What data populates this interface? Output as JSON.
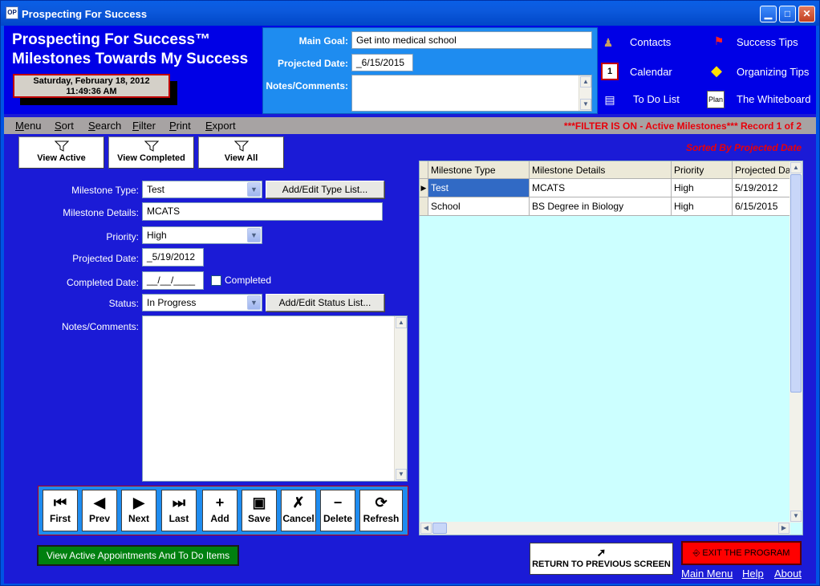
{
  "window": {
    "title": "Prospecting For Success",
    "icon_label": "OP"
  },
  "header": {
    "title_line1": "Prospecting For Success™",
    "title_line2": "Milestones Towards My Success",
    "date": "Saturday, February 18, 2012",
    "time": "11:49:36 AM"
  },
  "goal": {
    "main_goal_label": "Main Goal:",
    "main_goal_value": "Get into medical school",
    "projected_date_label": "Projected Date:",
    "projected_date_value": "_6/15/2015",
    "notes_label": "Notes/Comments:",
    "notes_value": ""
  },
  "quick_links": [
    {
      "label": "Contacts",
      "icon": "contacts-icon"
    },
    {
      "label": "Success Tips",
      "icon": "flag-icon"
    },
    {
      "label": "Calendar",
      "icon": "calendar-icon"
    },
    {
      "label": "Organizing Tips",
      "icon": "organizing-icon"
    },
    {
      "label": "To Do List",
      "icon": "todo-icon"
    },
    {
      "label": "The Whiteboard",
      "icon": "whiteboard-icon"
    }
  ],
  "menu": {
    "items": [
      "Menu",
      "Sort",
      "Search",
      "Filter",
      "Print",
      "Export"
    ],
    "filter_status": "***FILTER IS ON - Active Milestones***   Record 1 of 2"
  },
  "view_buttons": [
    "View Active",
    "View Completed",
    "View All"
  ],
  "sorted_by": "Sorted By Projected Date",
  "form": {
    "type_label": "Milestone Type:",
    "type_value": "Test",
    "type_button": "Add/Edit Type List...",
    "details_label": "Milestone Details:",
    "details_value": "MCATS",
    "priority_label": "Priority:",
    "priority_value": "High",
    "projected_label": "Projected Date:",
    "projected_value": "_5/19/2012",
    "completed_label": "Completed Date:",
    "completed_value": "__/__/____",
    "completed_check_label": "Completed",
    "status_label": "Status:",
    "status_value": "In Progress",
    "status_button": "Add/Edit Status List...",
    "notes_label": "Notes/Comments:",
    "notes_value": ""
  },
  "nav_buttons": [
    {
      "label": "First",
      "icon": "first-icon"
    },
    {
      "label": "Prev",
      "icon": "prev-icon"
    },
    {
      "label": "Next",
      "icon": "next-icon"
    },
    {
      "label": "Last",
      "icon": "last-icon"
    },
    {
      "label": "Add",
      "icon": "add-icon"
    },
    {
      "label": "Save",
      "icon": "save-icon"
    },
    {
      "label": "Cancel",
      "icon": "cancel-icon"
    },
    {
      "label": "Delete",
      "icon": "delete-icon"
    },
    {
      "label": "Refresh",
      "icon": "refresh-icon"
    }
  ],
  "appointments_button": "View Active Appointments And To Do Items",
  "grid": {
    "columns": [
      "Milestone Type",
      "Milestone Details",
      "Priority",
      "Projected Da"
    ],
    "rows": [
      [
        "Test",
        "MCATS",
        "High",
        "5/19/2012"
      ],
      [
        "School",
        "BS Degree in Biology",
        "High",
        "6/15/2015"
      ]
    ]
  },
  "return_button": "RETURN TO PREVIOUS SCREEN",
  "exit_button": "EXIT THE PROGRAM",
  "footer_links": [
    "Main Menu",
    "Help",
    "About"
  ]
}
